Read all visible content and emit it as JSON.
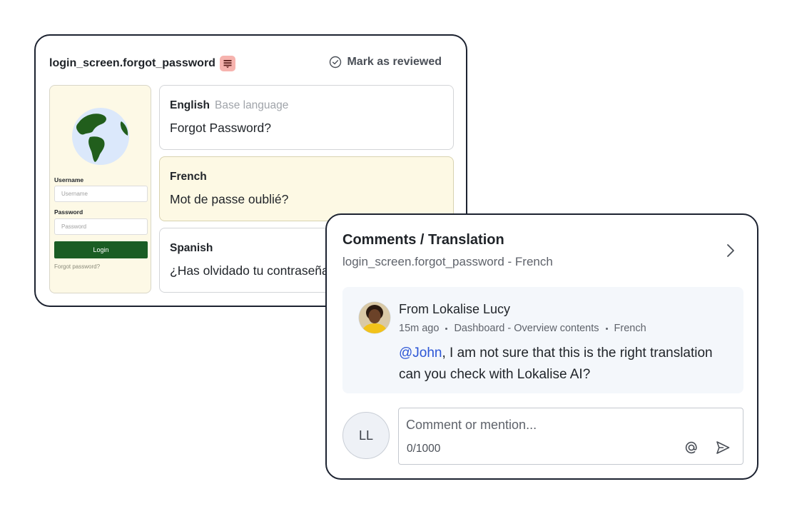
{
  "editor": {
    "key_name": "login_screen.forgot_password",
    "note_icon": "notes-icon",
    "mark_reviewed_label": "Mark as reviewed",
    "preview": {
      "username_label": "Username",
      "username_placeholder": "Username",
      "password_label": "Password",
      "password_placeholder": "Password",
      "login_button": "Login",
      "forgot_link": "Forgot password?"
    },
    "languages": [
      {
        "name": "English",
        "badge": "Base language",
        "text": "Forgot Password?"
      },
      {
        "name": "French",
        "badge": "",
        "text": "Mot de passe oublié?"
      },
      {
        "name": "Spanish",
        "badge": "",
        "text": "¿Has olvidado tu contraseña?"
      }
    ]
  },
  "comments": {
    "title": "Comments / Translation",
    "subtitle": "login_screen.forgot_password - French",
    "comment": {
      "from": "From Lokalise Lucy",
      "time": "15m ago",
      "location": "Dashboard - Overview contents",
      "language": "French",
      "mention": "@John",
      "body": ", I am not sure that this is the right translation can you check with Lokalise AI?"
    },
    "user_initials": "LL",
    "input_placeholder": "Comment or mention...",
    "char_count": "0/1000"
  },
  "colors": {
    "accent_green": "#1a5d24",
    "highlight_bg": "#fdf9e4",
    "mention_blue": "#2c56d6",
    "badge_pink": "#f6b3ae"
  }
}
